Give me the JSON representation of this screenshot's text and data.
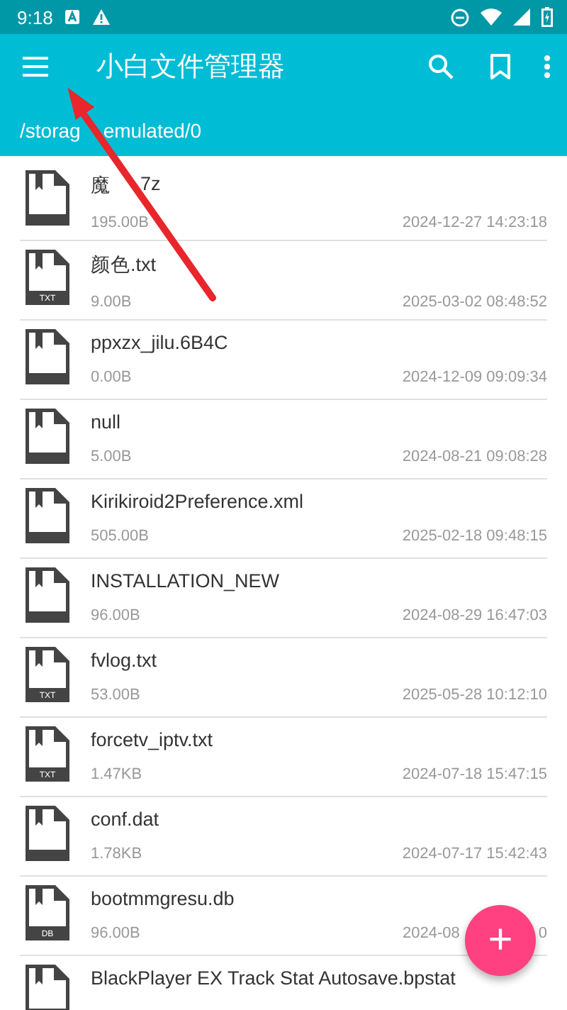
{
  "status_bar": {
    "time": "9:18"
  },
  "app_bar": {
    "title": "小白文件管理器"
  },
  "path": [
    "/storag",
    "emulated/0"
  ],
  "files": [
    {
      "name": [
        "魔",
        "7z"
      ],
      "size": "195.00B",
      "date": "2024-12-27 14:23:18",
      "kind": "plain"
    },
    {
      "name": "颜色.txt",
      "size": "9.00B",
      "date": "2025-03-02 08:48:52",
      "kind": "badge",
      "badge": "TXT"
    },
    {
      "name": "ppxzx_jilu.6B4C",
      "size": "0.00B",
      "date": "2024-12-09 09:09:34",
      "kind": "plain"
    },
    {
      "name": "null",
      "size": "5.00B",
      "date": "2024-08-21 09:08:28",
      "kind": "plain"
    },
    {
      "name": "Kirikiroid2Preference.xml",
      "size": "505.00B",
      "date": "2025-02-18 09:48:15",
      "kind": "plain"
    },
    {
      "name": "INSTALLATION_NEW",
      "size": "96.00B",
      "date": "2024-08-29 16:47:03",
      "kind": "plain"
    },
    {
      "name": "fvlog.txt",
      "size": "53.00B",
      "date": "2025-05-28 10:12:10",
      "kind": "badge",
      "badge": "TXT"
    },
    {
      "name": "forcetv_iptv.txt",
      "size": "1.47KB",
      "date": "2024-07-18 15:47:15",
      "kind": "badge",
      "badge": "TXT"
    },
    {
      "name": "conf.dat",
      "size": "1.78KB",
      "date": "2024-07-17 15:42:43",
      "kind": "plain"
    },
    {
      "name": "bootmmgresu.db",
      "size": "96.00B",
      "date": [
        "2024-08",
        "0"
      ],
      "kind": "badge",
      "badge": "DB"
    },
    {
      "name": "BlackPlayer EX Track Stat Autosave.bpstat",
      "kind": "plain"
    }
  ],
  "fab": {
    "label": "+"
  }
}
